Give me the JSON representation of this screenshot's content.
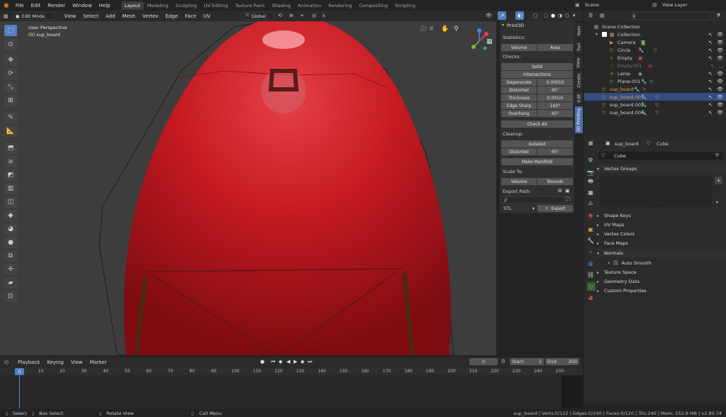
{
  "menus": [
    "File",
    "Edit",
    "Render",
    "Window",
    "Help"
  ],
  "workspaces": [
    "Layout",
    "Modeling",
    "Sculpting",
    "UV Editing",
    "Texture Paint",
    "Shading",
    "Animation",
    "Rendering",
    "Compositing",
    "Scripting"
  ],
  "scene": {
    "name": "Scene",
    "view_layer": "View Layer"
  },
  "viewport_header": {
    "mode": "Edit Mode",
    "items": [
      "View",
      "Select",
      "Add",
      "Mesh",
      "Vertex",
      "Edge",
      "Face",
      "UV"
    ],
    "orientation": "Global"
  },
  "viewport": {
    "perspective": "User Perspective",
    "object": "(0) sup_board"
  },
  "print3d": {
    "title": "Print3D",
    "statistics_label": "Statistics:",
    "volume": "Volume",
    "area": "Area",
    "checks_label": "Checks:",
    "solid": "Solid",
    "intersections": "Intersections",
    "checks": [
      {
        "label": "Degenerate",
        "value": "0.00010"
      },
      {
        "label": "Distorted",
        "value": "45°"
      },
      {
        "label": "Thickness",
        "value": "0.001m"
      },
      {
        "label": "Edge Sharp",
        "value": "160°"
      },
      {
        "label": "Overhang",
        "value": "45°"
      }
    ],
    "check_all": "Check All",
    "cleanup_label": "Cleanup:",
    "isolated": "Isolated",
    "distorted_label": "Distorted",
    "distorted_value": "45°",
    "make_manifold": "Make Manifold",
    "scale_to_label": "Scale To:",
    "scale_volume": "Volume",
    "scale_bounds": "Bounds",
    "export_path_label": "Export Path:",
    "export_path": "//",
    "format": "STL",
    "export": "Export"
  },
  "side_tabs": [
    "Item",
    "Tool",
    "View",
    "Create",
    "Edit",
    "3D Printing"
  ],
  "outliner": {
    "scene_collection": "Scene Collection",
    "collection": "Collection",
    "items": [
      "Camera",
      "Circle",
      "Empty",
      "Empty.001",
      "Lamp",
      "Plane.001",
      "sup_board",
      "sup_board.001",
      "sup_board.002",
      "sup_board.004"
    ]
  },
  "properties": {
    "object": "sup_board",
    "mesh": "Cube",
    "data_name": "Cube",
    "panels": [
      "Vertex Groups",
      "Shape Keys",
      "UV Maps",
      "Vertex Colors",
      "Face Maps",
      "Normals",
      "Texture Space",
      "Geometry Data",
      "Custom Properties"
    ],
    "auto_smooth": "Auto Smooth"
  },
  "timeline": {
    "menus": [
      "Playback",
      "Keying",
      "View",
      "Marker"
    ],
    "current_frame": "0",
    "start_label": "Start:",
    "start": "1",
    "end_label": "End:",
    "end": "250",
    "ticks": [
      "0",
      "10",
      "20",
      "30",
      "40",
      "50",
      "60",
      "70",
      "80",
      "90",
      "100",
      "110",
      "120",
      "130",
      "140",
      "150",
      "160",
      "170",
      "180",
      "190",
      "200",
      "210",
      "220",
      "230",
      "240",
      "250"
    ],
    "cursor": "0"
  },
  "statusbar": {
    "select": "Select",
    "box_select": "Box Select",
    "rotate_view": "Rotate View",
    "call_menu": "Call Menu",
    "stats": "sup_board | Verts:0/122 | Edges:0/240 | Faces:0/120 | Tris:240 | Mem: 152.8 MB | v2.80.74"
  },
  "colors": {
    "accent": "#5680c2",
    "board": "#c81e24",
    "selected_row": "#334d80"
  }
}
